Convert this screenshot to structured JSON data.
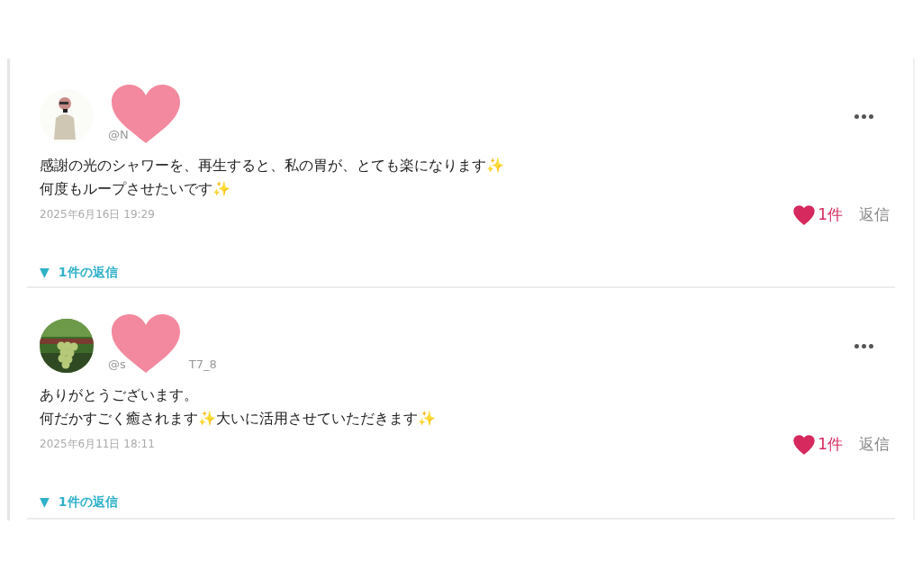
{
  "comments": [
    {
      "handle_start": "@N",
      "text": [
        "感謝の光のシャワーを、再生すると、私の胃が、とても楽になります✨",
        "何度もループさせたいです✨"
      ],
      "date": "2025年6月16日 19:29",
      "likes": "1件",
      "liked": true,
      "reply": "返信",
      "replies_toggle": "▼",
      "replies_label": "1件の返信"
    },
    {
      "handle_start": "@s",
      "handle_end": "T7_8",
      "text": [
        "ありがとうございます。",
        "何だかすごく癒されます✨大いに活用させていただきます✨"
      ],
      "date": "2025年6月11日 18:11",
      "likes": "1件",
      "liked": true,
      "reply": "返信",
      "replies_toggle": "▼",
      "replies_label": "1件の返信"
    }
  ]
}
